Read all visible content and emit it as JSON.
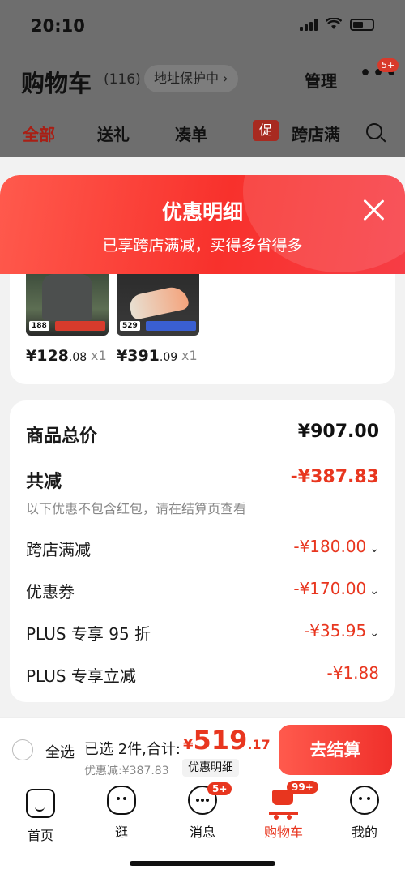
{
  "status_bar": {
    "time": "20:10"
  },
  "page": {
    "title": "购物车",
    "count": "(116)",
    "address_protect": "地址保护中 ›",
    "manage": "管理",
    "more": "•••",
    "more_badge": "5+"
  },
  "tabs": [
    {
      "label": "全部",
      "active": true
    },
    {
      "label": "送礼"
    },
    {
      "label": "凑单"
    },
    {
      "promo": "促",
      "label": "跨店满"
    }
  ],
  "sheet": {
    "title": "优惠明细",
    "subtitle": "已享跨店满减，买得多省得多"
  },
  "products": [
    {
      "thumb_price": "188",
      "price_int": "¥128",
      "price_dec": ".08",
      "qty": "x1"
    },
    {
      "thumb_price": "529",
      "price_int": "¥391",
      "price_dec": ".09",
      "qty": "x1"
    }
  ],
  "summary": {
    "total_label": "商品总价",
    "total_value": "¥907.00",
    "reduce_label": "共减",
    "reduce_value": "-¥387.83",
    "note": "以下优惠不包含红包，请在结算页查看",
    "items": [
      {
        "label": "跨店满减",
        "value": "-¥180.00",
        "chevron": "⌄"
      },
      {
        "label": "优惠券",
        "value": "-¥170.00",
        "chevron": "⌄"
      },
      {
        "label": "PLUS 专享 95 折",
        "value": "-¥35.95",
        "chevron": "⌄"
      },
      {
        "label": "PLUS 专享立减",
        "value": "-¥1.88",
        "chevron": ""
      }
    ]
  },
  "checkout": {
    "select_all": "全选",
    "selected_text": "已选 2件,合计:",
    "currency": "¥",
    "total_int": "519",
    "total_dec": ".17",
    "discount_text": "优惠减:¥387.83",
    "detail_chip": "优惠明细",
    "button": "去结算"
  },
  "tabbar": [
    {
      "label": "首页"
    },
    {
      "label": "逛"
    },
    {
      "label": "消息",
      "badge": "5+"
    },
    {
      "label": "购物车",
      "badge": "99+",
      "active": true
    },
    {
      "label": "我的"
    }
  ],
  "colors": {
    "accent": "#e8361f",
    "sheet_header": "#f8312c"
  }
}
